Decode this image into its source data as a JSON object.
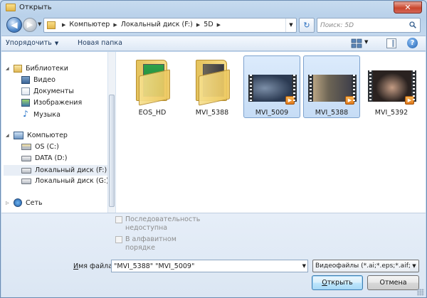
{
  "window": {
    "title": "Открыть",
    "close_glyph": "✕"
  },
  "nav": {
    "back_glyph": "◀",
    "forward_glyph": "▶",
    "crumbs": [
      "Компьютер",
      "Локальный диск (F:)",
      "5D"
    ],
    "refresh_glyph": "↻",
    "search_placeholder": "Поиск: 5D"
  },
  "toolbar": {
    "organize_label": "Упорядочить",
    "new_folder_label": "Новая папка",
    "help_label": "?"
  },
  "sidebar": {
    "libraries": {
      "label": "Библиотеки",
      "items": [
        {
          "label": "Видео",
          "icon": "video-library-icon"
        },
        {
          "label": "Документы",
          "icon": "documents-library-icon"
        },
        {
          "label": "Изображения",
          "icon": "images-library-icon"
        },
        {
          "label": "Музыка",
          "icon": "music-library-icon"
        }
      ]
    },
    "computer": {
      "label": "Компьютер",
      "items": [
        {
          "label": "OS (C:)",
          "icon": "windows-drive-icon"
        },
        {
          "label": "DATA (D:)",
          "icon": "drive-icon"
        },
        {
          "label": "Локальный диск (F:)",
          "icon": "drive-icon",
          "selected": true
        },
        {
          "label": "Локальный диск (G:)",
          "icon": "drive-icon"
        }
      ]
    },
    "network": {
      "label": "Сеть"
    }
  },
  "files": [
    {
      "name": "EOS_HD",
      "kind": "folder",
      "selected": false
    },
    {
      "name": "MVI_5388",
      "kind": "folder",
      "selected": false
    },
    {
      "name": "MVI_5009",
      "kind": "video",
      "selected": true
    },
    {
      "name": "MVI_5388",
      "kind": "video",
      "selected": true
    },
    {
      "name": "MVI_5392",
      "kind": "video",
      "selected": false
    }
  ],
  "options": {
    "sequence_line1": "Последовательность",
    "sequence_line2": "недоступна",
    "alpha_line1": "В алфавитном",
    "alpha_line2": "порядке"
  },
  "bottom": {
    "filename_label_prefix": "",
    "filename_label_access": "И",
    "filename_label_rest": "мя файла:",
    "filename_value": "\"MVI_5388\" \"MVI_5009\"",
    "filter_value": "Видеофайлы (*.ai;*.eps;*.aif;*.a",
    "open_label": "Открыть",
    "open_access": "О",
    "open_rest": "ткрыть",
    "cancel_label": "Отмена"
  },
  "colors": {
    "accent": "#3c7fb1",
    "selection": "#c6dcf5",
    "chrome": "#b9d1ea"
  }
}
